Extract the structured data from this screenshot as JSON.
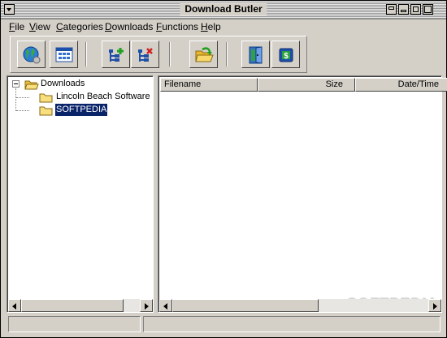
{
  "window": {
    "title": "Download Butler",
    "buttons": [
      "system-menu",
      "shade",
      "minimize",
      "maximize",
      "close"
    ]
  },
  "menubar": [
    {
      "label": "File",
      "underline": "F",
      "rest": "ile"
    },
    {
      "label": "View",
      "underline": "V",
      "rest": "iew"
    },
    {
      "label": "Categories",
      "underline": "C",
      "rest": "ategories"
    },
    {
      "label": "Downloads",
      "underline": "D",
      "rest": "ownloads"
    },
    {
      "label": "Functions",
      "underline": "F",
      "rest": "unctions"
    },
    {
      "label": "Help",
      "underline": "H",
      "rest": "elp"
    }
  ],
  "toolbar": {
    "buttons": [
      {
        "icon": "globe-icon"
      },
      {
        "icon": "window-grid-icon"
      },
      {
        "icon": "add-category-icon"
      },
      {
        "icon": "remove-category-icon"
      },
      {
        "icon": "open-folder-icon"
      },
      {
        "icon": "exit-door-icon"
      },
      {
        "icon": "money-icon"
      }
    ]
  },
  "tree": {
    "root": {
      "label": "Downloads",
      "expanded": true
    },
    "children": [
      {
        "label": "Lincoln Beach Software",
        "selected": false
      },
      {
        "label": "SOFTPEDIA",
        "selected": true
      }
    ]
  },
  "list": {
    "columns": [
      "Filename",
      "Size",
      "Date/Time"
    ],
    "rows": []
  },
  "watermark": "SOFTPEDIA",
  "statusbar": {
    "panels": [
      "",
      ""
    ]
  },
  "colors": {
    "face": "#d4d0c8",
    "selection": "#0a246a",
    "folder": "#f5d76e"
  }
}
